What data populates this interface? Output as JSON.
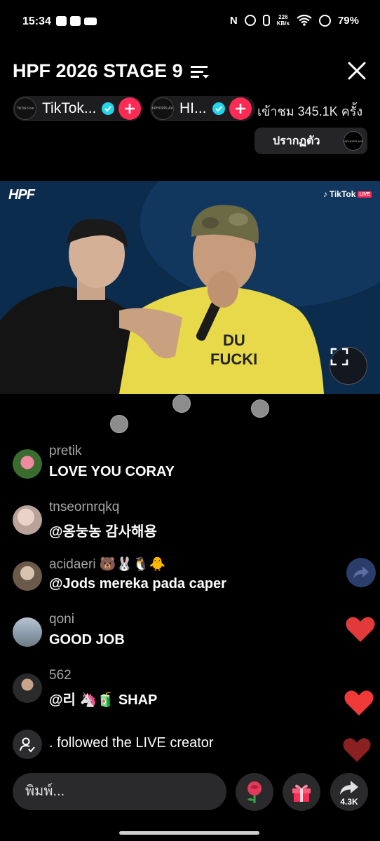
{
  "status_bar": {
    "time": "15:34",
    "net_speed_value": "226",
    "net_speed_unit": "KB/s",
    "battery": "79%"
  },
  "header": {
    "title": "HPF 2026 STAGE 9"
  },
  "hosts": [
    {
      "name": "TikTok...",
      "avatar_text": "TikTok Live"
    },
    {
      "name": "HI...",
      "avatar_text": "HIPHOPPLAYA"
    }
  ],
  "viewers": "เข้าชม 345.1K ครั้ง",
  "appear_button": {
    "label": "ปรากฏตัว",
    "avatar_text": "HIPHOPPLAYA"
  },
  "video": {
    "overlay_logo": "HPF",
    "platform_label": "TikTok",
    "live_badge": "LIVE"
  },
  "comments": [
    {
      "user": "pretik",
      "text": "LOVE YOU CORAY"
    },
    {
      "user": "tnseornrqkq",
      "text": "@옹눙농 감사해용"
    },
    {
      "user": "acidaeri 🐻🐰🐧🐥",
      "text": "@Jods mereka pada caper"
    },
    {
      "user": "qoni",
      "text": "GOOD JOB"
    },
    {
      "user": "562",
      "text": "@리 🦄🧃 SHAP"
    }
  ],
  "system_message": ". followed the LIVE creator",
  "bottom_bar": {
    "input_placeholder": "พิมพ์...",
    "share_count": "4.3K"
  },
  "colors": {
    "accent_red": "#fe2c55",
    "verified_blue": "#20d5ec",
    "heart_red": "#e23a3a"
  }
}
